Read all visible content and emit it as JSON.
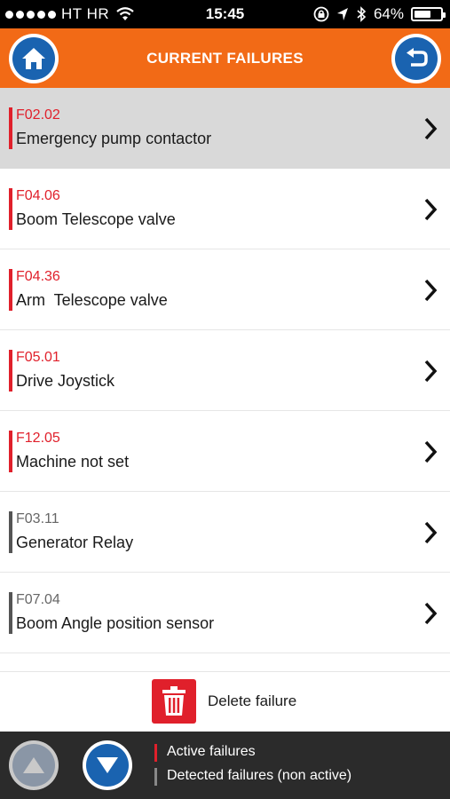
{
  "status_bar": {
    "carrier": "HT HR",
    "time": "15:45",
    "battery_text": "64%",
    "battery_level": 0.64
  },
  "header": {
    "title": "CURRENT FAILURES",
    "home_icon": "home-icon",
    "back_icon": "back-arrow-icon",
    "color": "#f26a16"
  },
  "failures": [
    {
      "code": "F02.02",
      "name": "Emergency pump contactor",
      "status": "active",
      "selected": true
    },
    {
      "code": "F04.06",
      "name": "Boom Telescope valve",
      "status": "active",
      "selected": false
    },
    {
      "code": "F04.36",
      "name": "Arm  Telescope valve",
      "status": "active",
      "selected": false
    },
    {
      "code": "F05.01",
      "name": "Drive Joystick",
      "status": "active",
      "selected": false
    },
    {
      "code": "F12.05",
      "name": "Machine not set",
      "status": "active",
      "selected": false
    },
    {
      "code": "F03.11",
      "name": "Generator Relay",
      "status": "detected",
      "selected": false
    },
    {
      "code": "F07.04",
      "name": "Boom Angle position sensor",
      "status": "detected",
      "selected": false
    }
  ],
  "delete": {
    "label": "Delete failure",
    "icon": "trash-icon"
  },
  "legend": {
    "active": "Active failures",
    "detected": "Detected failures (non active)"
  },
  "colors": {
    "active": "#e0202b",
    "detected": "#555555",
    "accent_blue": "#1a63b0"
  }
}
